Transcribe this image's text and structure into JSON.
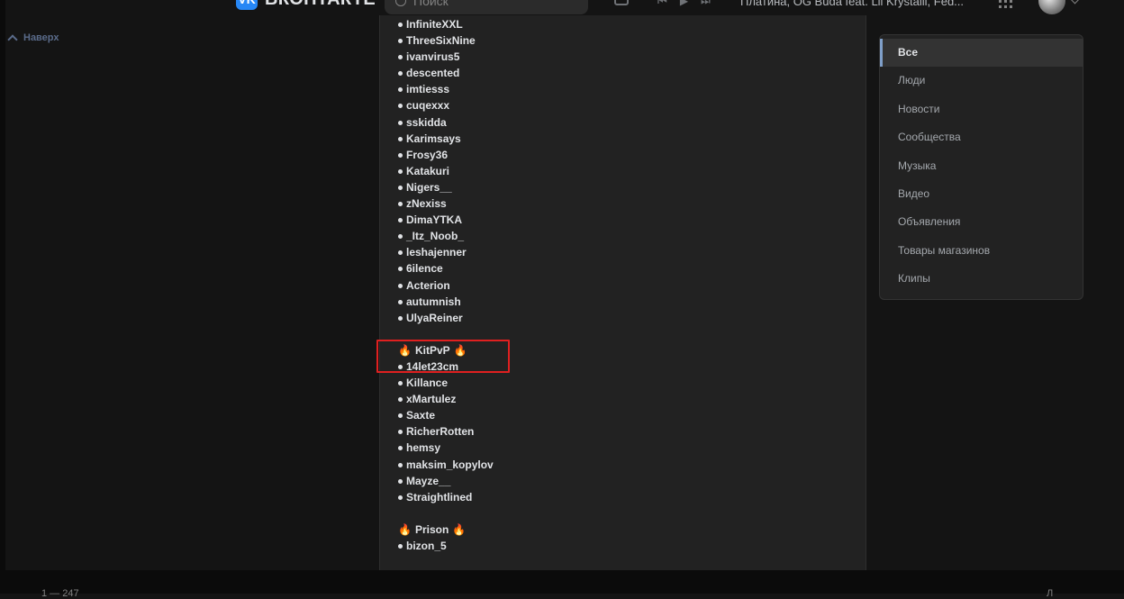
{
  "header": {
    "logo_mark": "VK",
    "logo_text": "ВКОНТАКТЕ",
    "search_placeholder": "Поиск",
    "track": "Платина, OG Buda feat. Lil Krystalll, Fed...",
    "icons": [
      "vk-logo-icon",
      "search-icon",
      "bell-icon",
      "prev-track-icon",
      "play-icon",
      "next-track-icon",
      "apps-grid-icon",
      "avatar",
      "chevron-down-icon"
    ]
  },
  "scroll_top": {
    "label": "Наверх"
  },
  "post": {
    "items": [
      {
        "type": "name",
        "text": "InfiniteXXL"
      },
      {
        "type": "name",
        "text": "ThreeSixNine"
      },
      {
        "type": "name",
        "text": "ivanvirus5"
      },
      {
        "type": "name",
        "text": "descented"
      },
      {
        "type": "name",
        "text": "imtiesss"
      },
      {
        "type": "name",
        "text": "cuqexxx"
      },
      {
        "type": "name",
        "text": "sskidda"
      },
      {
        "type": "name",
        "text": "Karimsays"
      },
      {
        "type": "name",
        "text": "Frosy36"
      },
      {
        "type": "name",
        "text": "Katakuri"
      },
      {
        "type": "name",
        "text": "Nigers__"
      },
      {
        "type": "name",
        "text": "zNexiss"
      },
      {
        "type": "name",
        "text": "DimaYTKA"
      },
      {
        "type": "name",
        "text": "_Itz_Noob_"
      },
      {
        "type": "name",
        "text": "leshajenner"
      },
      {
        "type": "name",
        "text": "6ilence"
      },
      {
        "type": "name",
        "text": "Acterion"
      },
      {
        "type": "name",
        "text": "autumnish"
      },
      {
        "type": "name",
        "text": "UlyaReiner"
      },
      {
        "type": "gap"
      },
      {
        "type": "section",
        "text": "KitPvP"
      },
      {
        "type": "name",
        "text": "14let23cm"
      },
      {
        "type": "name",
        "text": "Killance"
      },
      {
        "type": "name",
        "text": "xMartulez"
      },
      {
        "type": "name",
        "text": "Saxte"
      },
      {
        "type": "name",
        "text": "RicherRotten"
      },
      {
        "type": "name",
        "text": "hemsy"
      },
      {
        "type": "name",
        "text": "maksim_kopylov"
      },
      {
        "type": "name",
        "text": "Mayze__"
      },
      {
        "type": "name",
        "text": "Straightlined"
      },
      {
        "type": "gap"
      },
      {
        "type": "section",
        "text": "Prison"
      },
      {
        "type": "name",
        "text": "bizon_5"
      }
    ],
    "fire_icon": "🔥"
  },
  "filters": {
    "items": [
      {
        "label": "Все",
        "active": true
      },
      {
        "label": "Люди",
        "active": false
      },
      {
        "label": "Новости",
        "active": false
      },
      {
        "label": "Сообщества",
        "active": false
      },
      {
        "label": "Музыка",
        "active": false
      },
      {
        "label": "Видео",
        "active": false
      },
      {
        "label": "Объявления",
        "active": false
      },
      {
        "label": "Товары магазинов",
        "active": false
      },
      {
        "label": "Клипы",
        "active": false
      }
    ]
  },
  "footer": {
    "left_text": "1 — 247",
    "right_text": "Л"
  },
  "colors": {
    "accent": "#2787f5",
    "highlight_border": "#e02020",
    "panel_bg": "#222222",
    "page_bg": "#141414"
  }
}
